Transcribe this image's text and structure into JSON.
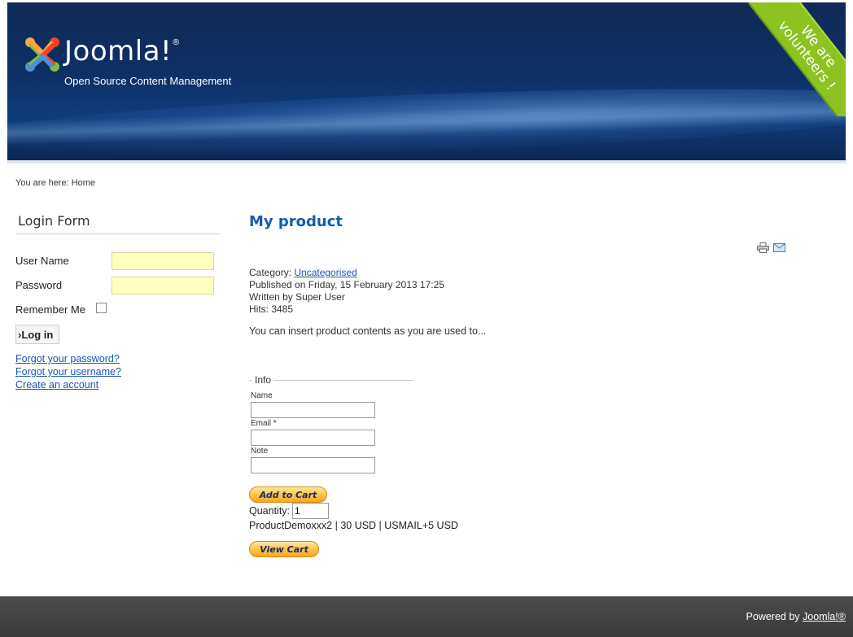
{
  "header": {
    "logo_text": "Joomla!",
    "logo_reg": "®",
    "tagline": "Open Source Content Management",
    "ribbon": "We are\nvolunteers !"
  },
  "breadcrumb": {
    "text": "You are here:  Home"
  },
  "login": {
    "title": "Login Form",
    "username_label": "User Name",
    "password_label": "Password",
    "remember_label": "Remember Me",
    "button_label": "›Log in",
    "links": [
      "Forgot your password?",
      "Forgot your username?",
      "Create an account"
    ]
  },
  "article": {
    "title": "My product",
    "category_label": "Category: ",
    "category_value": "Uncategorised",
    "published": "Published on Friday, 15 February 2013 17:25",
    "written_by": "Written by Super User",
    "hits": "Hits: 3485",
    "body": "You can insert product contents as you are used to..."
  },
  "form": {
    "legend": "Info",
    "name_label": "Name",
    "email_label": "Email *",
    "note_label": "Note",
    "add_to_cart": "Add to Cart",
    "quantity_label": "Quantity:",
    "quantity_value": "1",
    "product_line": "ProductDemoxxx2 | 30 USD | USMAIL+5 USD",
    "view_cart": "View Cart"
  },
  "footer": {
    "prefix": "Powered by ",
    "link": "Joomla!®"
  },
  "colors": {
    "link": "#1b57b1",
    "title": "#135cae",
    "ribbon": "#8cc320",
    "input_highlight": "#ffffc0"
  }
}
